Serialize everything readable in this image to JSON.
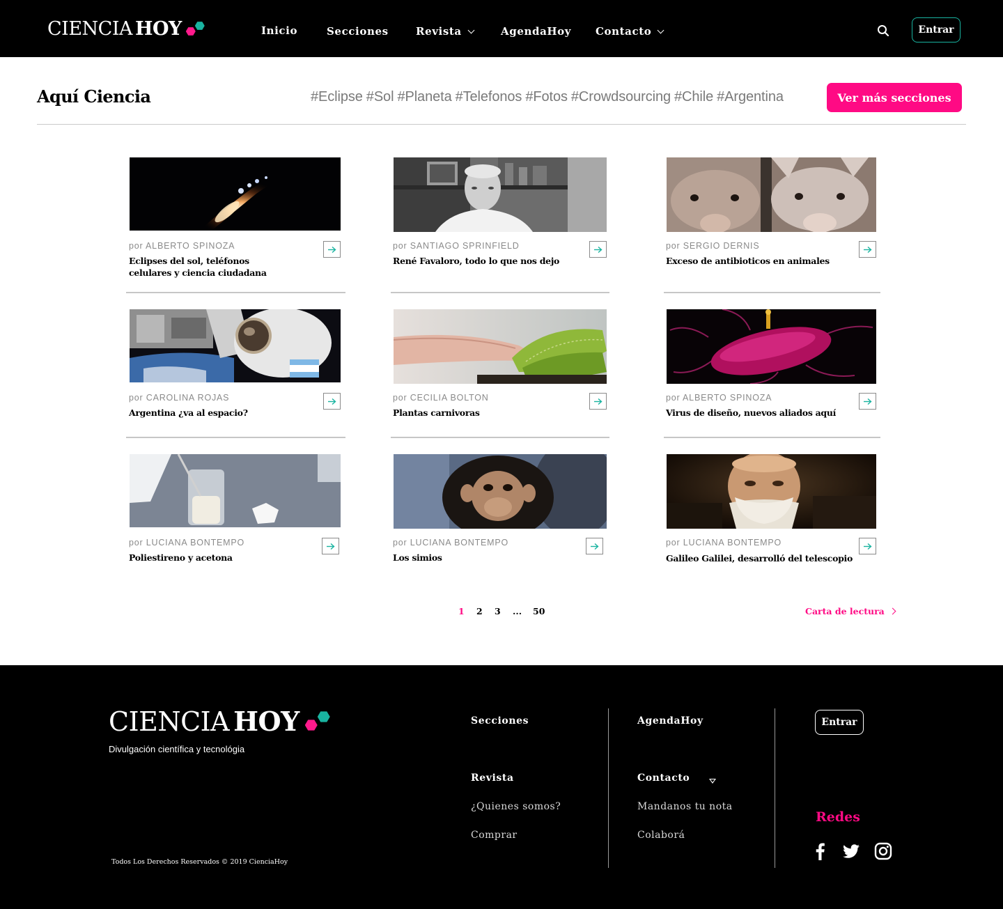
{
  "brand": {
    "word1": "CIENCIA",
    "word2": "HOY",
    "pink": "#ff0a84",
    "teal": "#19b3a0"
  },
  "nav": {
    "items": [
      {
        "label": "Inicio",
        "has_dropdown": false
      },
      {
        "label": "Secciones",
        "has_dropdown": false
      },
      {
        "label": "Revista",
        "has_dropdown": true
      },
      {
        "label": "AgendaHoy",
        "has_dropdown": false
      },
      {
        "label": "Contacto",
        "has_dropdown": true
      }
    ],
    "search_icon": "search-icon",
    "login_label": "Entrar"
  },
  "section": {
    "title": "Aquí Ciencia",
    "tags": [
      "#Eclipse",
      "#Sol",
      "#Planeta",
      "#Telefonos",
      "#Fotos",
      "#Crowdsourcing",
      "#Chile",
      "#Argentina"
    ],
    "more_button": "Ver más secciones"
  },
  "articles": [
    {
      "author": "por ALBERTO SPINOZA",
      "title": "Eclipses del sol, teléfonos celulares y ciencia ciudadana",
      "image": "eclipse-photo"
    },
    {
      "author": "por SANTIAGO SPRINFIELD",
      "title": "René Favaloro, todo lo que nos dejo",
      "image": "portrait-photo"
    },
    {
      "author": "por SERGIO DERNIS",
      "title": "Exceso de antibioticos en animales",
      "image": "pigs-photo"
    },
    {
      "author": "por CAROLINA ROJAS",
      "title": "Argentina ¿va al espacio?",
      "image": "astronaut-photo"
    },
    {
      "author": "por CECILIA BOLTON",
      "title": "Plantas carnivoras",
      "image": "venus-flytrap-photo"
    },
    {
      "author": "por ALBERTO SPINOZA",
      "title": "Virus de diseño, nuevos aliados aquí",
      "image": "bacteria-render"
    },
    {
      "author": "por LUCIANA  BONTEMPO",
      "title": "Poliestireno y acetona",
      "image": "beaker-photo"
    },
    {
      "author": "por LUCIANA  BONTEMPO",
      "title": "Los simios",
      "image": "chimpanzee-photo"
    },
    {
      "author": "por LUCIANA  BONTEMPO",
      "title": "Galileo Galilei, desarrolló del telescopio",
      "image": "galileo-painting"
    }
  ],
  "pagination": {
    "current": "1",
    "pages": [
      "2",
      "3",
      "...",
      "50"
    ],
    "carta_label": "Carta de lectura"
  },
  "footer": {
    "tagline": "Divulgación científica y tecnológia",
    "copyright": "Todos Los Derechos Reservados © 2019 CienciaHoy",
    "col1": {
      "head1": "Secciones",
      "head2": "Revista",
      "link1": "¿Quienes somos?",
      "link2": "Comprar"
    },
    "col2": {
      "head1": "AgendaHoy",
      "head2": "Contacto",
      "link1": "Mandanos tu nota",
      "link2": "Colaborá"
    },
    "login_label": "Entrar",
    "social_title": "Redes",
    "social_icons": [
      "facebook-icon",
      "twitter-icon",
      "instagram-icon"
    ]
  }
}
